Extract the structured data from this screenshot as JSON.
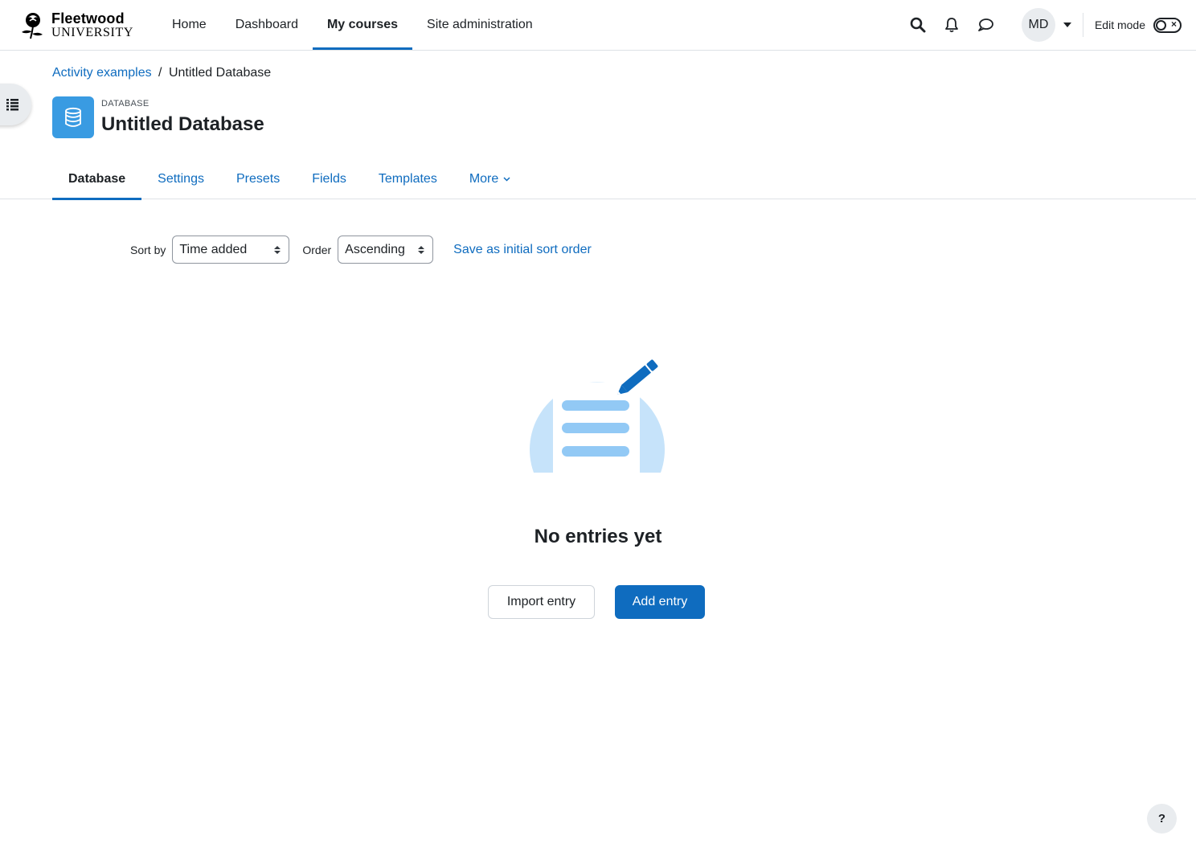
{
  "brand": {
    "name": "Fleetwood",
    "subtitle": "UNIVERSITY"
  },
  "primary_nav": {
    "items": [
      {
        "label": "Home",
        "active": false
      },
      {
        "label": "Dashboard",
        "active": false
      },
      {
        "label": "My courses",
        "active": true
      },
      {
        "label": "Site administration",
        "active": false
      }
    ]
  },
  "user_menu": {
    "initials": "MD",
    "edit_mode_label": "Edit mode",
    "edit_mode_on": false
  },
  "icons": {
    "search": "search-icon",
    "notifications": "bell-icon",
    "messages": "chat-bubble-icon",
    "drawer": "list-icon",
    "activity": "database-icon",
    "help": "question-mark-icon"
  },
  "breadcrumb": {
    "parent": "Activity examples",
    "separator": "/",
    "current": "Untitled Database"
  },
  "page_header": {
    "module_name": "DATABASE",
    "title": "Untitled Database"
  },
  "secondary_nav": {
    "tabs": [
      {
        "label": "Database",
        "active": true
      },
      {
        "label": "Settings",
        "active": false
      },
      {
        "label": "Presets",
        "active": false
      },
      {
        "label": "Fields",
        "active": false
      },
      {
        "label": "Templates",
        "active": false
      },
      {
        "label": "More",
        "active": false
      }
    ]
  },
  "sort": {
    "sort_by_label": "Sort by",
    "sort_by_value": "Time added",
    "order_label": "Order",
    "order_value": "Ascending",
    "save_link": "Save as initial sort order"
  },
  "empty_state": {
    "title": "No entries yet",
    "import_button": "Import entry",
    "add_button": "Add entry"
  },
  "help": {
    "label": "?"
  },
  "colors": {
    "accent": "#0f6cbf",
    "activity_icon_bg": "#399be2",
    "illustration_light": "#c6e3fa",
    "illustration_mid": "#92c9f5"
  }
}
